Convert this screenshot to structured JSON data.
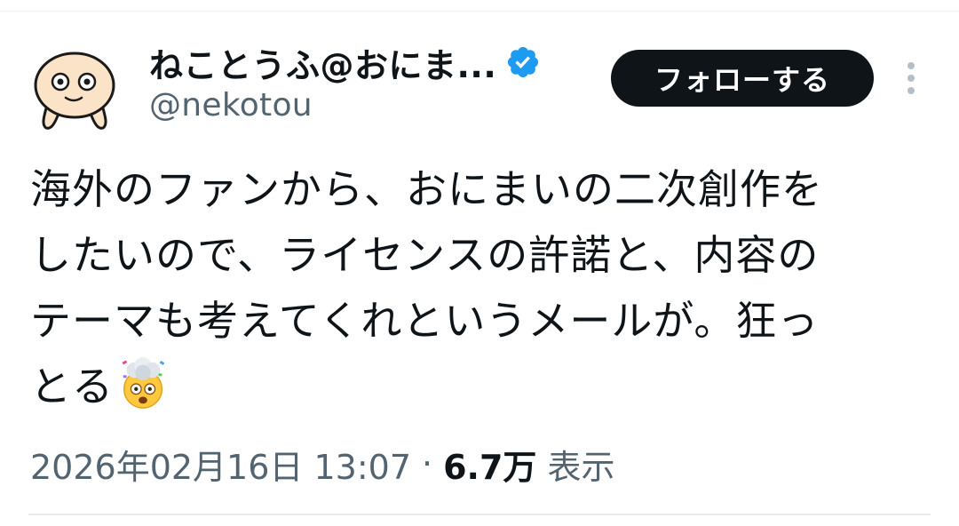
{
  "tweet": {
    "author": {
      "display_name": "ねことうふ@おにま...",
      "handle": "@nekotou",
      "verified": true,
      "avatar_icon": "cartoon-character-avatar-icon"
    },
    "follow_label": "フォローする",
    "more_icon": "vertical-dots-icon",
    "text_lines": [
      "海外のファンから、おにまいの二次創作を",
      "したいので、ライセンスの許諾と、内容の",
      "テーマも考えてくれというメールが。狂っ",
      "とる"
    ],
    "emoji": "exploding-head-icon",
    "timestamp": "2026年02月16日 13:07",
    "separator": "·",
    "views_count": "6.7万",
    "views_label": "表示",
    "colors": {
      "primary_text": "#0f1419",
      "secondary_text": "#536471",
      "follow_bg": "#0f1419",
      "verified_blue": "#1d9bf0",
      "divider": "#e7ecef"
    }
  }
}
